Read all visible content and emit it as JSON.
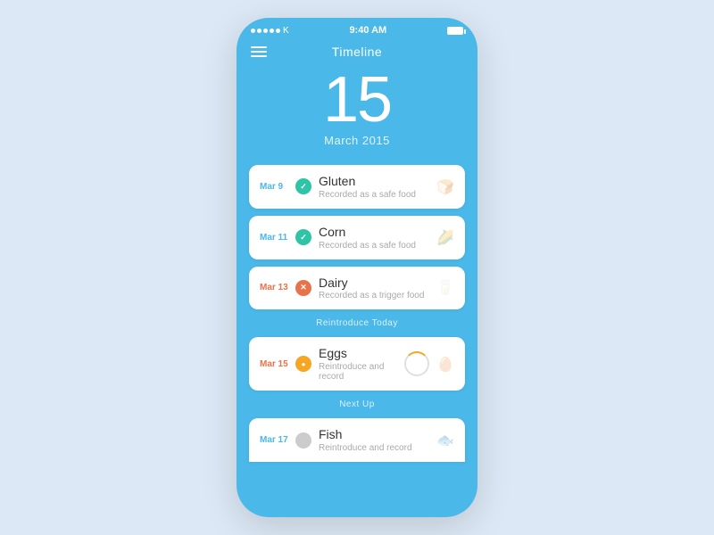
{
  "statusBar": {
    "carrier": "K",
    "time": "9:40 AM"
  },
  "header": {
    "title": "Timeline",
    "menuIcon": "hamburger-icon"
  },
  "date": {
    "day": "15",
    "monthYear": "March 2015"
  },
  "sections": {
    "reintroduceLabel": "Reintroduce Today",
    "nextUpLabel": "Next Up"
  },
  "cards": [
    {
      "date": "Mar 9",
      "dateType": "safe",
      "statusType": "safe",
      "foodName": "Gluten",
      "subtitle": "Recorded as a safe food",
      "icon": "bread-icon"
    },
    {
      "date": "Mar 11",
      "dateType": "safe",
      "statusType": "safe",
      "foodName": "Corn",
      "subtitle": "Recorded as a safe food",
      "icon": "corn-icon"
    },
    {
      "date": "Mar 13",
      "dateType": "trigger",
      "statusType": "trigger",
      "foodName": "Dairy",
      "subtitle": "Recorded as a trigger food",
      "icon": "dairy-icon"
    },
    {
      "date": "Mar 15",
      "dateType": "today",
      "statusType": "pending",
      "foodName": "Eggs",
      "subtitle": "Reintroduce and record",
      "icon": "egg-icon"
    },
    {
      "date": "Mar 17",
      "dateType": "safe",
      "statusType": "future",
      "foodName": "Fish",
      "subtitle": "Reintroduce and record",
      "icon": "fish-icon"
    }
  ]
}
